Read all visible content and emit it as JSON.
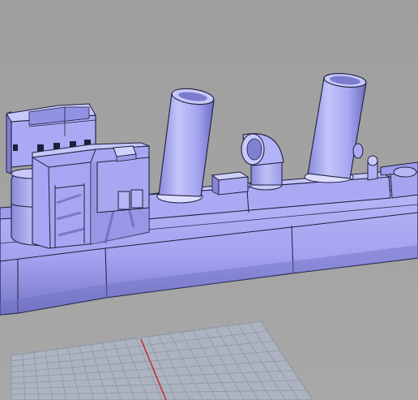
{
  "viewport": {
    "projection": "perspective",
    "display_mode": "shaded",
    "background_color": "#a3a3a3"
  },
  "model": {
    "object": "ship-hull-model",
    "parts": [
      "hull",
      "deck",
      "bridge-tower",
      "forward-funnel",
      "aft-funnel",
      "ventilator-cowl",
      "deck-box",
      "deck-gun"
    ],
    "colors": {
      "surface": "#aaaaf4",
      "surface_light": "#c8c8fb",
      "surface_shade": "#7f7fd0",
      "edge": "#1e1e3c"
    }
  },
  "grid": {
    "visible": true,
    "line_color": "#8d96a8",
    "axis_color": "#c03030"
  }
}
